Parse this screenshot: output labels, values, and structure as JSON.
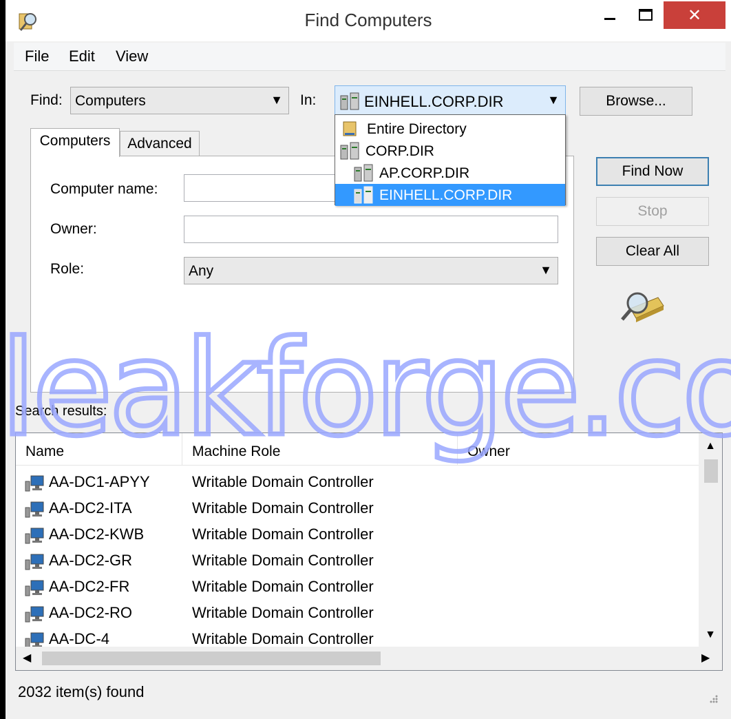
{
  "window": {
    "title": "Find Computers",
    "close_glyph": "✕"
  },
  "menu": {
    "items": [
      "File",
      "Edit",
      "View"
    ]
  },
  "find_row": {
    "find_label": "Find:",
    "find_value": "Computers",
    "in_label": "In:",
    "in_value": "EINHELL.CORP.DIR",
    "browse_label": "Browse..."
  },
  "domain_dropdown": {
    "options": [
      {
        "label": "Entire Directory",
        "icon": "directory-icon"
      },
      {
        "label": "CORP.DIR",
        "icon": "domain-tree-icon"
      },
      {
        "label": "AP.CORP.DIR",
        "icon": "domain-tree-icon"
      },
      {
        "label": "EINHELL.CORP.DIR",
        "icon": "domain-tree-icon",
        "selected": true
      }
    ]
  },
  "tabs": [
    "Computers",
    "Advanced"
  ],
  "form": {
    "computer_name_label": "Computer name:",
    "computer_name_value": "",
    "owner_label": "Owner:",
    "owner_value": "",
    "role_label": "Role:",
    "role_value": "Any"
  },
  "actions": {
    "find_now": "Find Now",
    "stop": "Stop",
    "clear_all": "Clear All"
  },
  "results": {
    "label": "Search results:",
    "columns": [
      "Name",
      "Machine Role",
      "Owner"
    ],
    "rows": [
      {
        "name": "AA-DC1-APYY",
        "role": "Writable Domain Controller"
      },
      {
        "name": "AA-DC2-ITA",
        "role": "Writable Domain Controller"
      },
      {
        "name": "AA-DC2-KWB",
        "role": "Writable Domain Controller"
      },
      {
        "name": "AA-DC2-GR",
        "role": "Writable Domain Controller"
      },
      {
        "name": "AA-DC2-FR",
        "role": "Writable Domain Controller"
      },
      {
        "name": "AA-DC2-RO",
        "role": "Writable Domain Controller"
      },
      {
        "name": "AA-DC-4",
        "role": "Writable Domain Controller"
      }
    ]
  },
  "status": {
    "text": "2032 item(s) found"
  },
  "watermark": {
    "text": "leakforge.com"
  },
  "colors": {
    "accent": "#3399ff",
    "close_button": "#c9403a",
    "default_button_border": "#3c7fb1"
  }
}
